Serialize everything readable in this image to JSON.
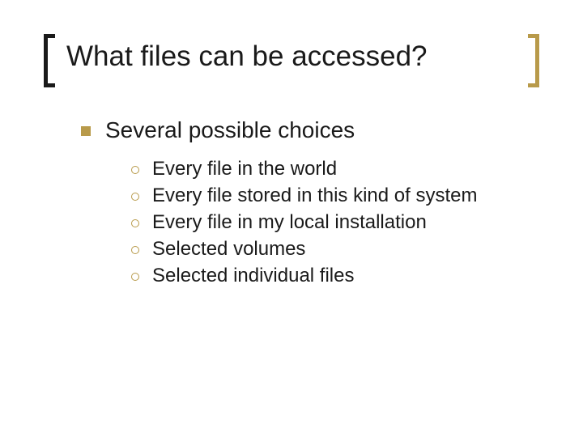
{
  "slide": {
    "title": "What files can be accessed?",
    "section_heading": "Several possible choices",
    "items": {
      "0": "Every file in the world",
      "1": "Every file stored in this kind of system",
      "2": "Every file in my local installation",
      "3": "Selected volumes",
      "4": "Selected individual files"
    }
  },
  "colors": {
    "accent": "#b89a4a",
    "text": "#1a1a1a"
  }
}
